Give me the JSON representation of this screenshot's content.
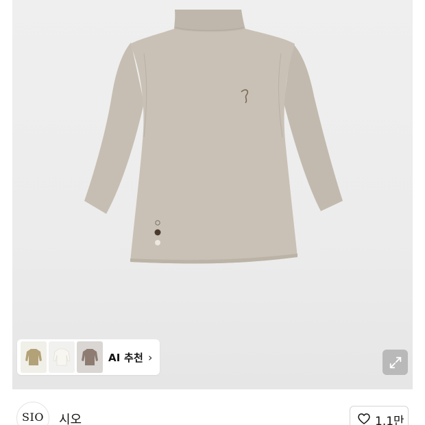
{
  "ai_recommend": {
    "label": "AI 추천",
    "chevron": "›",
    "thumbnails": [
      {
        "name": "olive-top-thumbnail",
        "color": "#b3a278"
      },
      {
        "name": "ivory-top-thumbnail",
        "color": "#ecebe4"
      },
      {
        "name": "brown-top-thumbnail",
        "color": "#8e7c72"
      }
    ]
  },
  "product": {
    "color": "#c7bfb3",
    "icon": "mock-neck-top-image"
  },
  "expand": {
    "icon": "expand-icon"
  },
  "brand": {
    "logo_text": "SIO",
    "name": "시오"
  },
  "like": {
    "icon": "heart-icon",
    "count": "1.1만"
  }
}
